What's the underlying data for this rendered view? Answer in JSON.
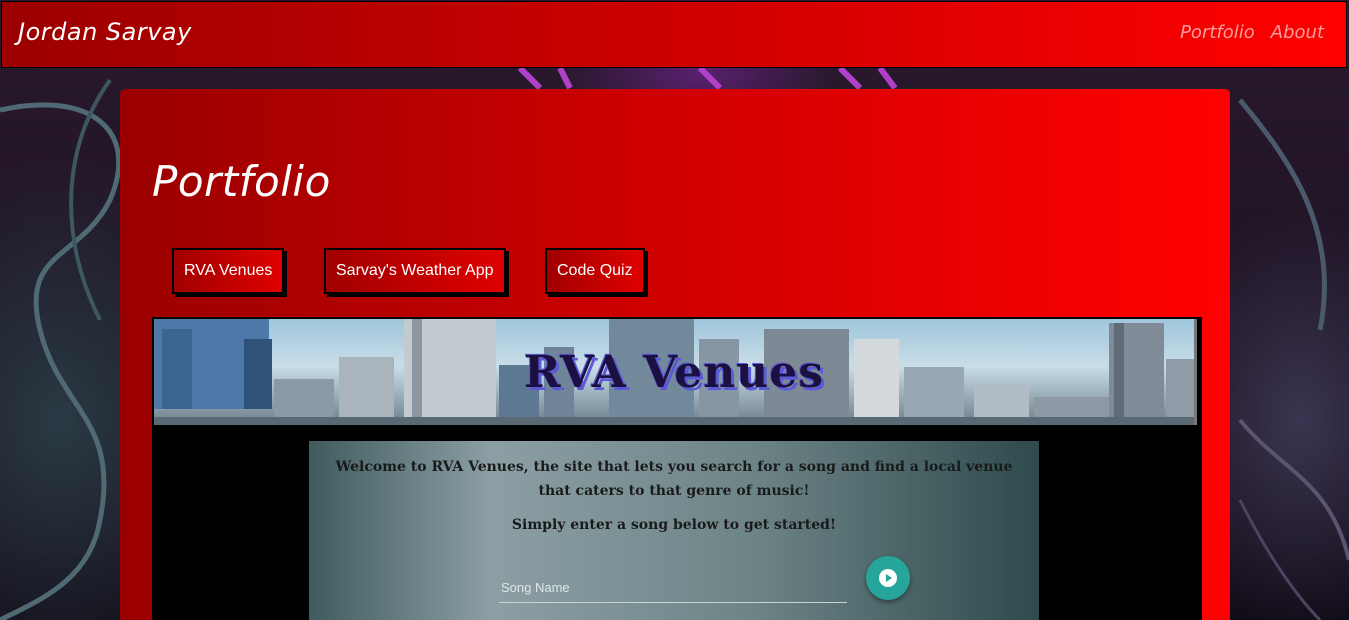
{
  "navbar": {
    "brand": "Jordan Sarvay",
    "links": [
      {
        "label": "Portfolio"
      },
      {
        "label": "About"
      }
    ]
  },
  "page": {
    "title": "Portfolio"
  },
  "projects": [
    {
      "label": "RVA Venues"
    },
    {
      "label": "Sarvay's Weather App"
    },
    {
      "label": "Code Quiz"
    }
  ],
  "preview": {
    "banner_title": "RVA Venues",
    "welcome": "Welcome to RVA Venues, the site that lets you search for a song and find a local venue that caters to that genre of music!",
    "start": "Simply enter a song below to get started!",
    "search": {
      "placeholder": "Song Name",
      "value": ""
    },
    "submit_icon": "play-circle-icon"
  },
  "colors": {
    "navbar_start": "#9c0000",
    "navbar_end": "#ff0000",
    "nav_link": "#ff9c9c",
    "play_button": "#26a69a"
  }
}
